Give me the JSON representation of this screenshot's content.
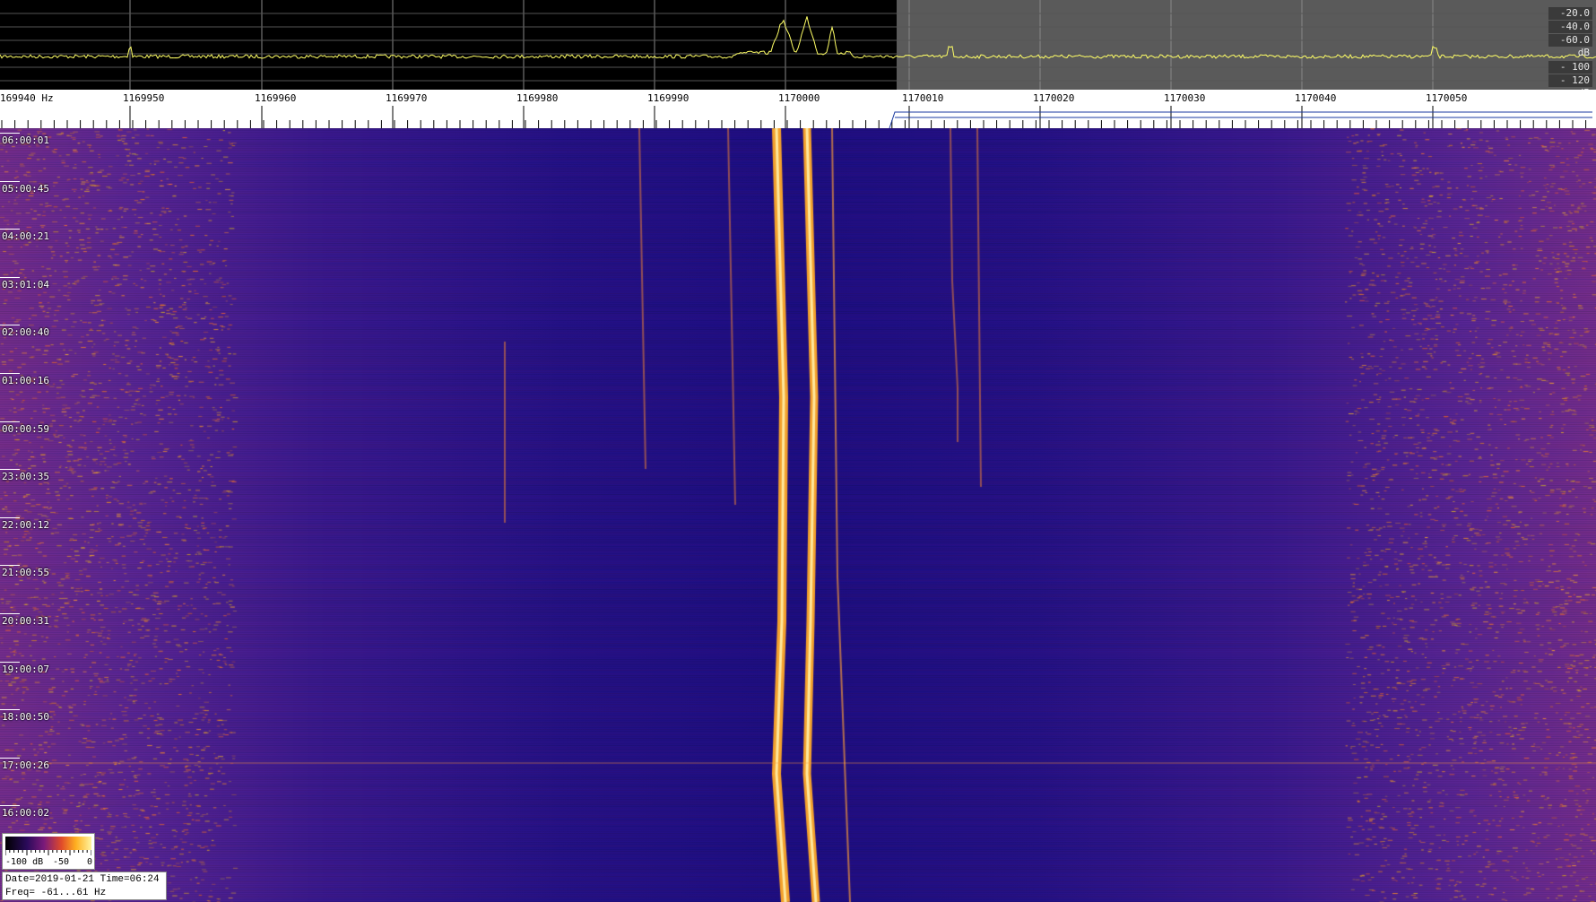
{
  "spectrum": {
    "db_labels": [
      "-20.0 dB",
      "-40.0 dB",
      "-60.0 dB",
      "- 100 dB",
      "- 120 dB"
    ],
    "trace_color": "#ffff66"
  },
  "ruler": {
    "freq_labels": [
      "169940 Hz",
      "1169950",
      "1169960",
      "1169970",
      "1169980",
      "1169990",
      "1170000",
      "1170010",
      "1170020",
      "1170030",
      "1170040",
      "1170050"
    ]
  },
  "waterfall": {
    "time_labels": [
      "06:00:01",
      "05:00:45",
      "04:00:21",
      "03:01:04",
      "02:00:40",
      "01:00:16",
      "00:00:59",
      "23:00:35",
      "22:00:12",
      "21:00:55",
      "20:00:31",
      "19:00:07",
      "18:00:50",
      "17:00:26",
      "16:00:02"
    ]
  },
  "colorbar": {
    "min_label": "-100 dB",
    "mid_label": "-50",
    "max_label": "0"
  },
  "info": {
    "line1": "Date=2019-01-21 Time=06:24",
    "line2": "Freq= -61...61 Hz"
  }
}
